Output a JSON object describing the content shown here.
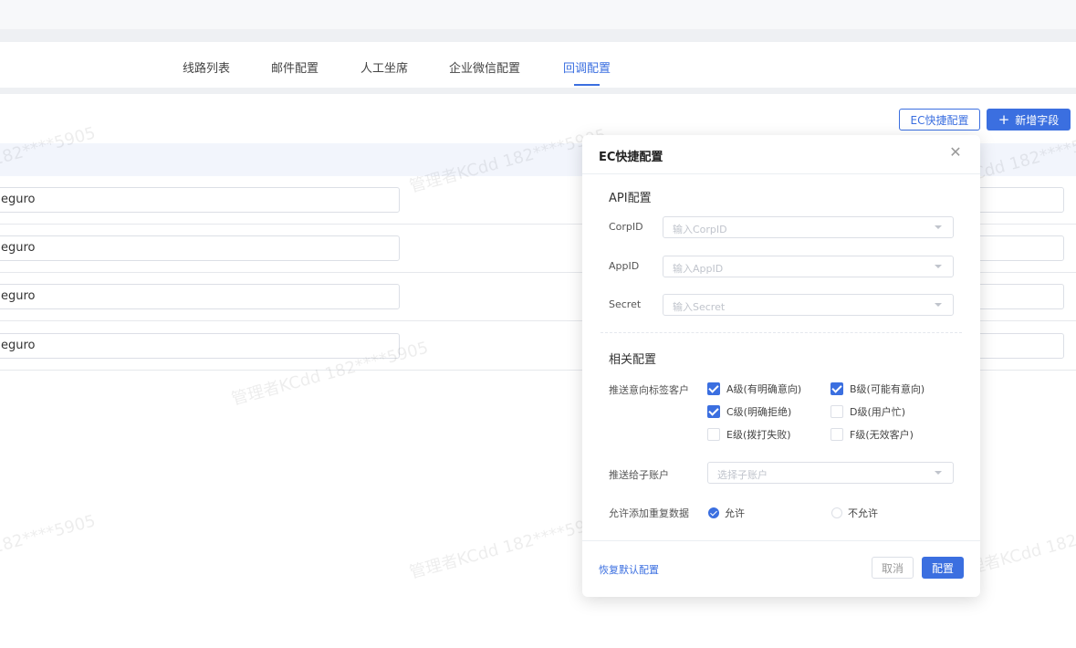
{
  "tabs": [
    {
      "label": "线路列表"
    },
    {
      "label": "邮件配置"
    },
    {
      "label": "人工坐席"
    },
    {
      "label": "企业微信配置"
    },
    {
      "label": "回调配置"
    }
  ],
  "active_tab": "回调配置",
  "toolbar": {
    "ec_quick_label": "EC快捷配置",
    "add_field_label": "新增字段"
  },
  "table": {
    "rows": [
      {
        "value": "eguro"
      },
      {
        "value": "eguro"
      },
      {
        "value": "eguro"
      },
      {
        "value": "eguro"
      }
    ]
  },
  "watermark": {
    "text_short": "182****5905",
    "text_long": "管理者KCdd 182****5905"
  },
  "modal": {
    "title": "EC快捷配置",
    "api_section": "API配置",
    "fields": [
      {
        "label": "CorpID",
        "placeholder": "输入CorpID"
      },
      {
        "label": "AppID",
        "placeholder": "输入AppID"
      },
      {
        "label": "Secret",
        "placeholder": "输入Secret"
      }
    ],
    "related_section": "相关配置",
    "push_tag_label": "推送意向标签客户",
    "levels": [
      {
        "label": "A级(有明确意向)",
        "checked": true
      },
      {
        "label": "B级(可能有意向)",
        "checked": true
      },
      {
        "label": "C级(明确拒绝)",
        "checked": true
      },
      {
        "label": "D级(用户忙)",
        "checked": false
      },
      {
        "label": "E级(拨打失败)",
        "checked": false
      },
      {
        "label": "F级(无效客户)",
        "checked": false
      }
    ],
    "push_account_label": "推送给子账户",
    "push_account_placeholder": "选择子账户",
    "allow_dup_label": "允许添加重复数据",
    "allow_options": [
      {
        "label": "允许",
        "selected": true
      },
      {
        "label": "不允许",
        "selected": false
      }
    ],
    "reset_label": "恢复默认配置",
    "cancel_label": "取消",
    "confirm_label": "配置"
  },
  "colors": {
    "accent": "#3b6fe0",
    "header_bg": "#f2f5fc"
  }
}
